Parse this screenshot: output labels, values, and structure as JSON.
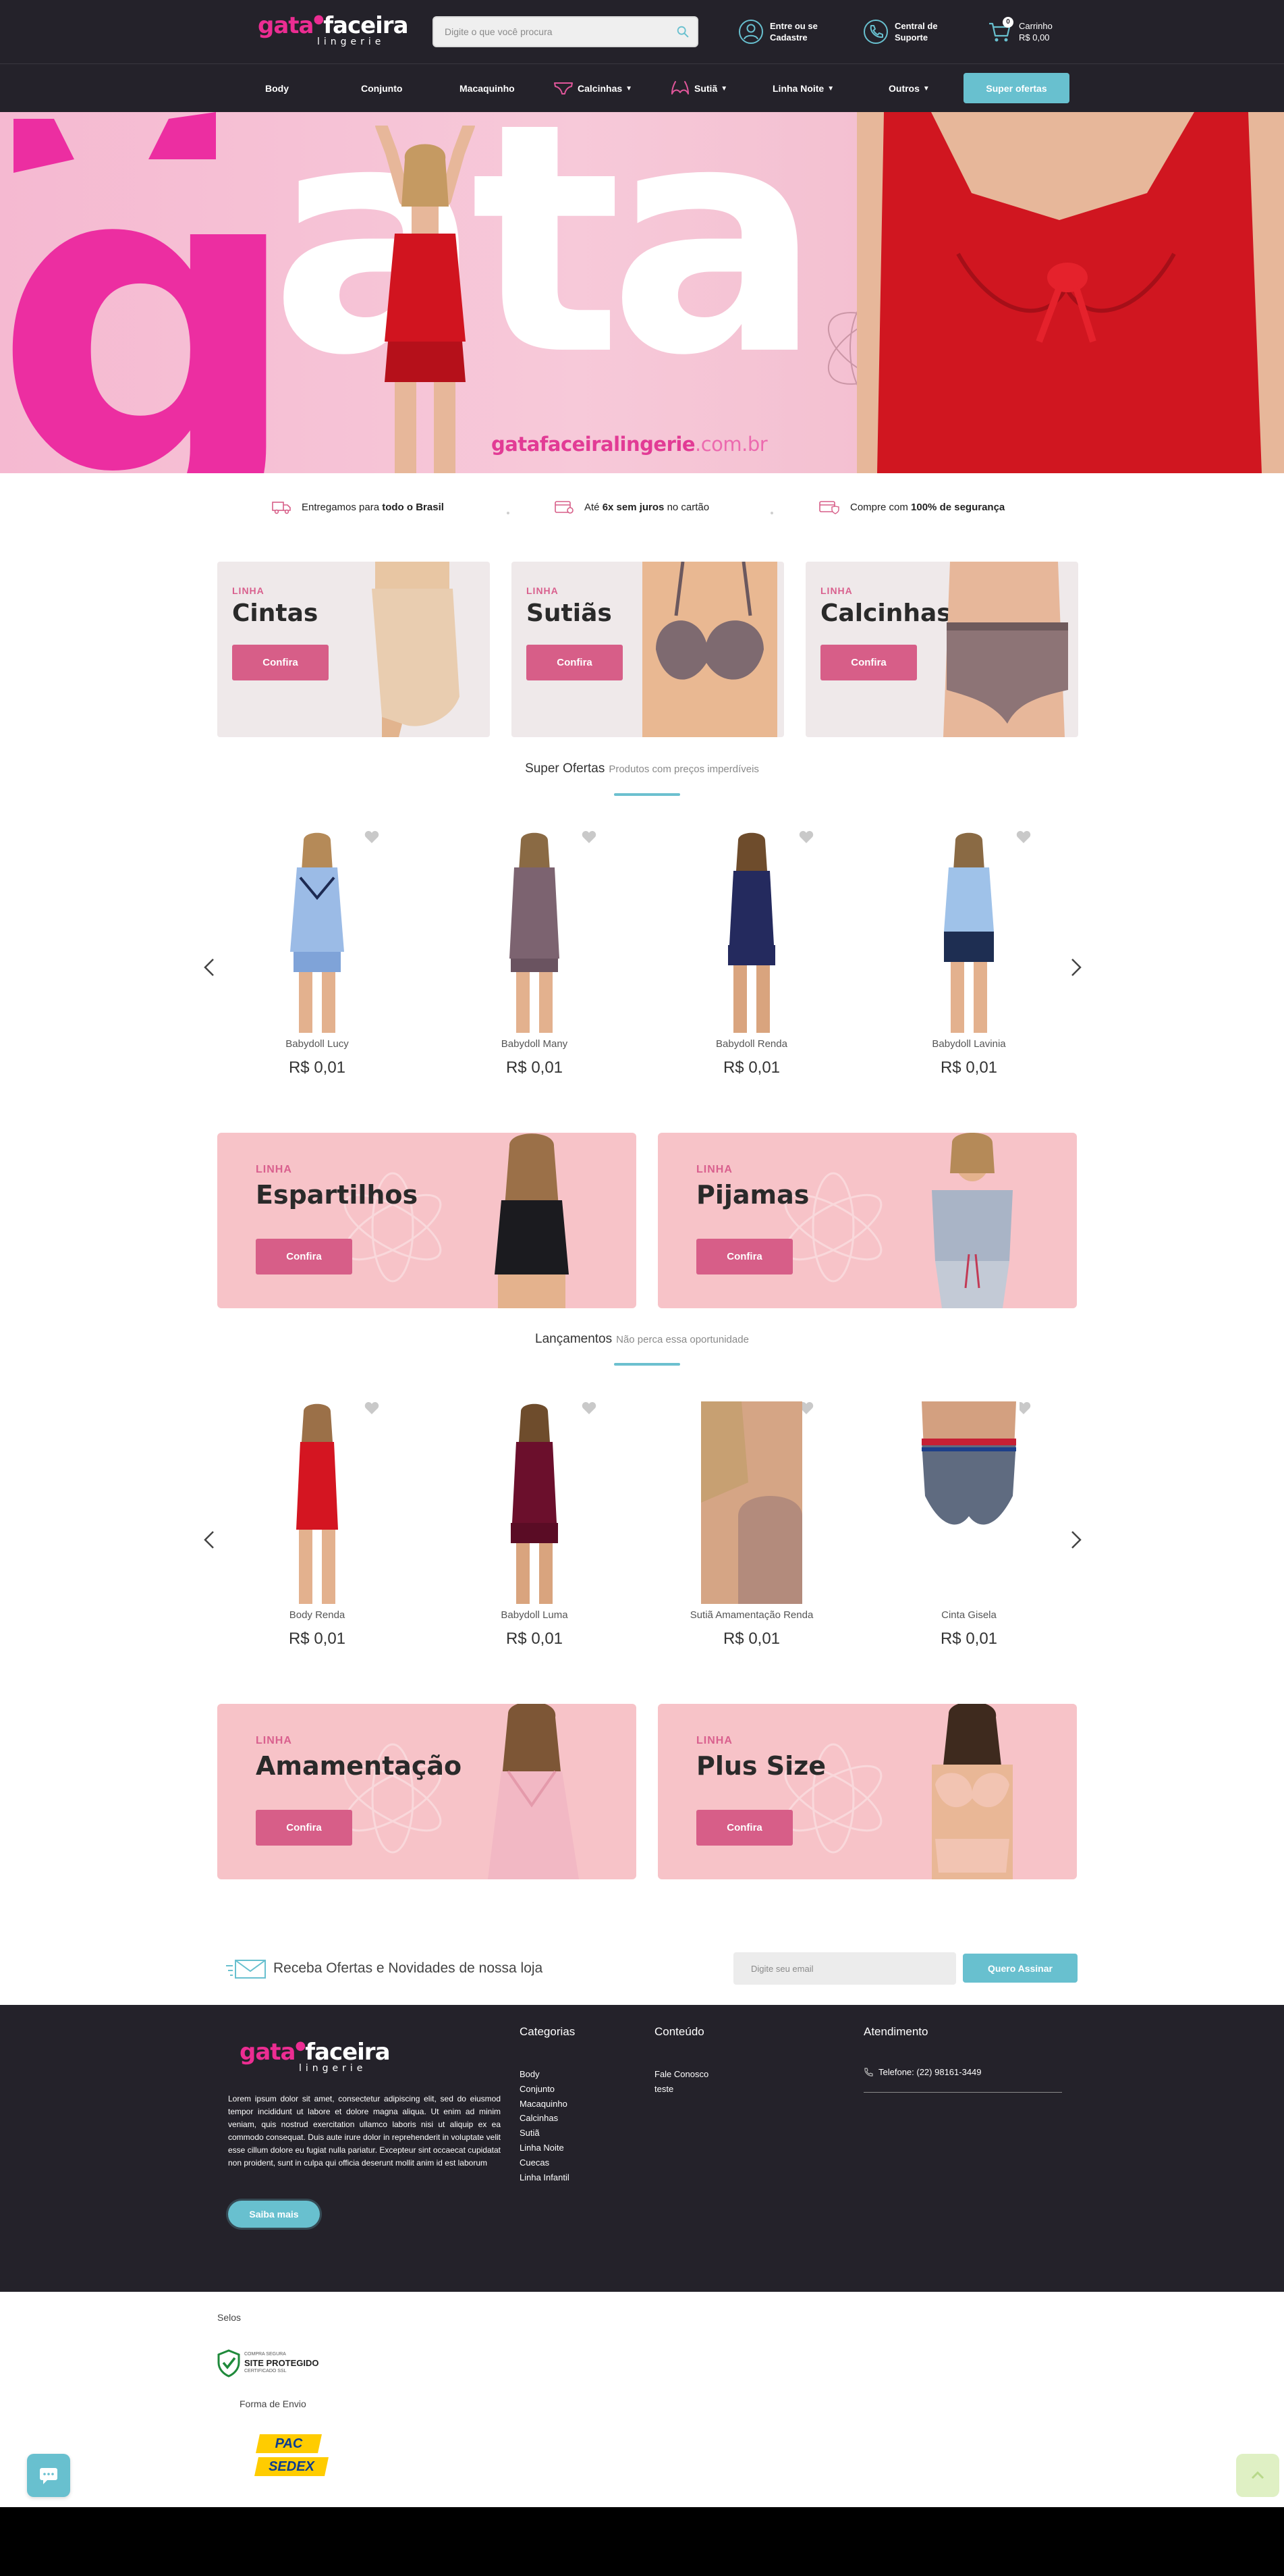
{
  "brand": {
    "logo_main_pink": "gata",
    "logo_main_white": "faceira",
    "logo_sub": "lingerie"
  },
  "header": {
    "search_placeholder": "Digite o que você procura",
    "account_line1": "Entre ou se",
    "account_line2": "Cadastre",
    "support_line1": "Central de",
    "support_line2": "Suporte",
    "cart_label": "Carrinho",
    "cart_total": "R$ 0,00",
    "cart_count": "0"
  },
  "nav": {
    "items": [
      "Body",
      "Conjunto",
      "Macaquinho",
      "Calcinhas",
      "Sutiã",
      "Linha Noite",
      "Outros"
    ],
    "offers_button": "Super ofertas"
  },
  "hero": {
    "url_bold": "gatafaceiralingerie",
    "url_light": ".com.br",
    "g": "g",
    "ata": "ata"
  },
  "benefits": [
    {
      "pre": "Entregamos para ",
      "bold": "todo o Brasil",
      "post": ""
    },
    {
      "pre": "Até ",
      "bold": "6x sem juros",
      "post": " no cartão"
    },
    {
      "pre": "Compre com ",
      "bold": "100% de segurança",
      "post": ""
    }
  ],
  "categories": [
    {
      "prefix": "LINHA",
      "name": "Cintas",
      "button": "Confira"
    },
    {
      "prefix": "LINHA",
      "name": "Sutiãs",
      "button": "Confira"
    },
    {
      "prefix": "LINHA",
      "name": "Calcinhas",
      "button": "Confira"
    }
  ],
  "super_offers": {
    "title": "Super Ofertas",
    "subtitle": "Produtos com preços imperdíveis",
    "products": [
      {
        "name": "Babydoll Lucy",
        "price": "R$ 0,01"
      },
      {
        "name": "Babydoll Many",
        "price": "R$ 0,01"
      },
      {
        "name": "Babydoll Renda",
        "price": "R$ 0,01"
      },
      {
        "name": "Babydoll Lavinia",
        "price": "R$ 0,01"
      }
    ]
  },
  "banners_row1": [
    {
      "prefix": "LINHA",
      "name": "Espartilhos",
      "button": "Confira"
    },
    {
      "prefix": "LINHA",
      "name": "Pijamas",
      "button": "Confira"
    }
  ],
  "launches": {
    "title": "Lançamentos",
    "subtitle": "Não perca essa oportunidade",
    "products": [
      {
        "name": "Body Renda",
        "price": "R$ 0,01"
      },
      {
        "name": "Baby​doll Luma",
        "price": "R$ 0,01"
      },
      {
        "name": "Sutiã Amamentação Renda",
        "price": "R$ 0,01"
      },
      {
        "name": "Cinta Gisela",
        "price": "R$ 0,01"
      }
    ]
  },
  "banners_row2": [
    {
      "prefix": "LINHA",
      "name": "Amamentação",
      "button": "Confira"
    },
    {
      "prefix": "LINHA",
      "name": "Plus Size",
      "button": "Confira"
    }
  ],
  "newsletter": {
    "text": "Receba Ofertas e Novidades de nossa loja",
    "placeholder": "Digite seu email",
    "button": "Quero Assinar"
  },
  "footer": {
    "description": "Lorem ipsum dolor sit amet, consectetur adipiscing elit, sed do eiusmod tempor incididunt ut labore et dolore magna aliqua. Ut enim ad minim veniam, quis nostrud exercitation ullamco laboris nisi ut aliquip ex ea commodo consequat. Duis aute irure dolor in reprehenderit in voluptate velit esse cillum dolore eu fugiat nulla pariatur. Excepteur sint occaecat cupidatat non proident, sunt in culpa qui officia deserunt mollit anim id est laborum",
    "more_button": "Saiba mais",
    "categories_title": "Categorias",
    "categories": [
      "Body",
      "Conjunto",
      "Macaquinho",
      "Calcinhas",
      "Sutiã",
      "Linha Noite",
      "Cuecas",
      "Linha Infantil"
    ],
    "content_title": "Conteúdo",
    "content": [
      "Fale Conosco",
      "teste"
    ],
    "service_title": "Atendimento",
    "phone": "Telefone: (22) 98161-3449"
  },
  "seals": {
    "title": "Selos",
    "site_line1": "SITE PROTEGIDO",
    "site_small1": "COMPRA SEGURA",
    "site_small2": "CERTIFICADO SSL"
  },
  "shipping": {
    "title": "Forma de Envio",
    "pac": "PAC",
    "sedex": "SEDEX"
  },
  "colors": {
    "header_bg": "#24222a",
    "accent_teal": "#68c0cf",
    "brand_pink": "#ec2d92",
    "button_pink": "#d75e88",
    "banner_pink": "#f7c3c8"
  }
}
